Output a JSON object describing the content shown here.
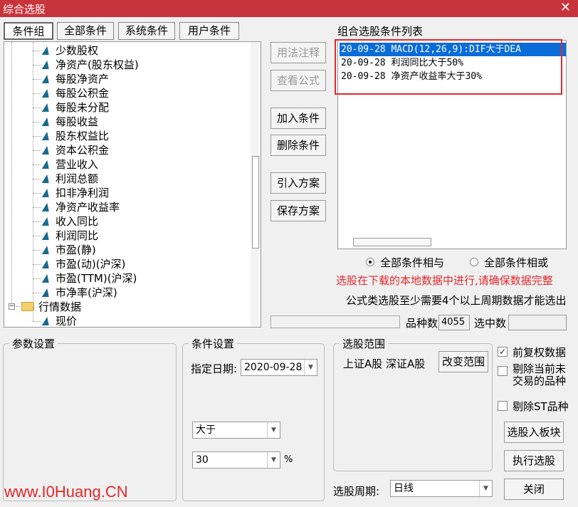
{
  "window": {
    "title": "综合选股",
    "close_glyph": "✕"
  },
  "tabs": [
    "条件组",
    "全部条件",
    "系统条件",
    "用户条件"
  ],
  "tree": {
    "items": [
      "少数股权",
      "净资产(股东权益)",
      "每股净资产",
      "每股公积金",
      "每股未分配",
      "每股收益",
      "股东权益比",
      "资本公积金",
      "营业收入",
      "利润总额",
      "扣非净利润",
      "净资产收益率",
      "收入同比",
      "利润同比",
      "市盈(静)",
      "市盈(动)(沪深)",
      "市盈(TTM)(沪深)",
      "市净率(沪深)"
    ],
    "folder": "行情数据",
    "folder_expander": "−",
    "folder_child": "现价"
  },
  "buttons": {
    "usage_note": "用法注释",
    "view_formula": "查看公式",
    "add_condition": "加入条件",
    "delete_condition": "删除条件",
    "import_scheme": "引入方案",
    "save_scheme": "保存方案",
    "change_range": "改变范围",
    "select_into_block": "选股入板块",
    "execute": "执行选股",
    "close": "关闭"
  },
  "condition_list": {
    "title": "组合选股条件列表",
    "items": [
      "20-09-28 MACD(12,26,9):DIF大于DEA",
      "20-09-28 利润同比大于50%",
      "20-09-28 净资产收益率大于30%"
    ],
    "selected_index": 0
  },
  "logic": {
    "and_label": "全部条件相与",
    "or_label": "全部条件相或",
    "selected": "and"
  },
  "warning_text": "选股在下载的本地数据中进行,请确保数据完整",
  "info_text": "公式类选股至少需要4个以上周期数据才能选出",
  "stats": {
    "count_label": "品种数",
    "count_value": "4055",
    "selected_label": "选中数",
    "selected_value": ""
  },
  "params": {
    "title": "参数设置"
  },
  "condition_settings": {
    "title": "条件设置",
    "date_label": "指定日期:",
    "date_value": "2020-09-28",
    "operator": "大于",
    "value": "30",
    "unit": "%"
  },
  "range": {
    "title": "选股范围",
    "markets": "上证A股  深证A股"
  },
  "options": {
    "adjusted": {
      "label": "前复权数据",
      "checked": true
    },
    "exclude_untraded": {
      "label_line1": "剔除当前未",
      "label_line2": "交易的品种",
      "checked": false
    },
    "exclude_st": {
      "label": "剔除ST品种",
      "checked": false
    }
  },
  "period": {
    "label": "选股周期:",
    "value": "日线"
  },
  "icons": {
    "combo_arrow": "▼",
    "check_mark": "✓"
  },
  "watermark": "www.I0Huang.CN",
  "colors": {
    "title_bar": "#c8343b",
    "warning": "#e0292f",
    "selection": "#0a6cd8",
    "highlight_box": "#e0292f"
  }
}
